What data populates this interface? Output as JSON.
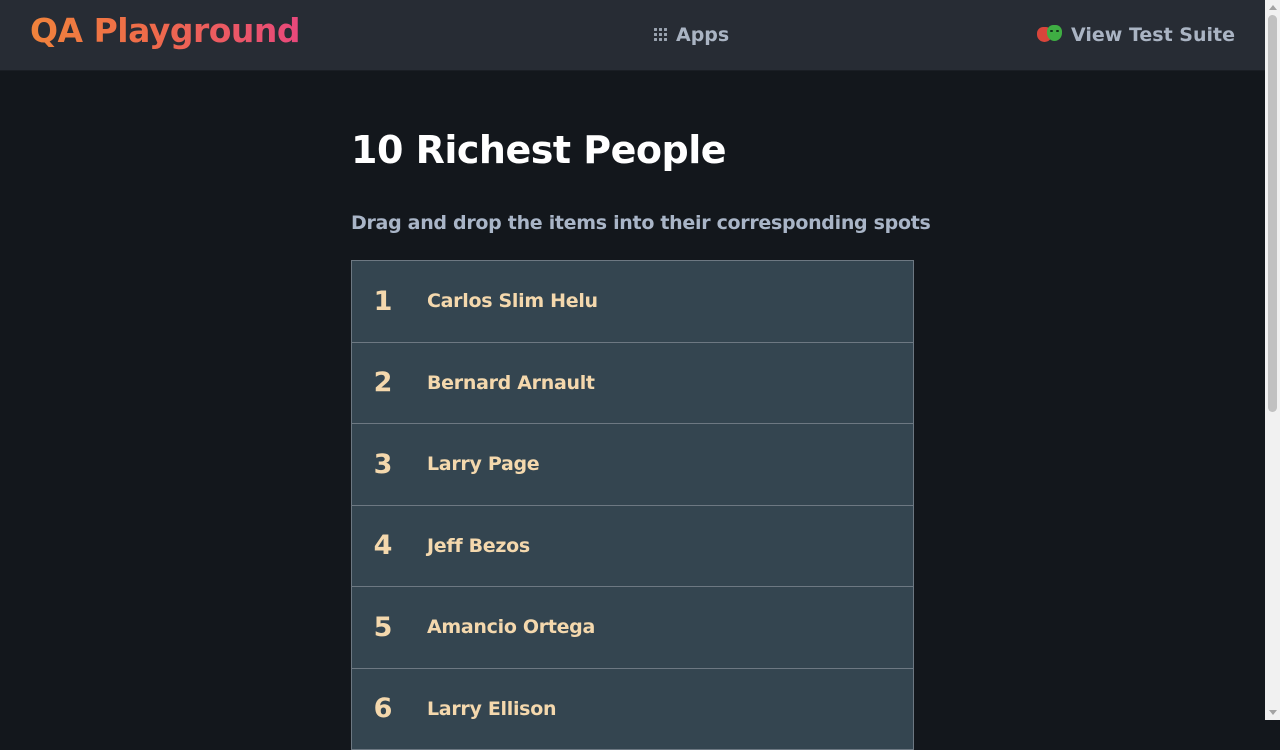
{
  "navbar": {
    "brand": "QA Playground",
    "apps_label": "Apps",
    "apps_icon": "grid-icon",
    "suite_label": "View Test Suite",
    "suite_icon": "theater-masks-icon"
  },
  "main": {
    "title": "10 Richest People",
    "subtitle": "Drag and drop the items into their corresponding spots",
    "items": [
      {
        "rank": "1",
        "name": "Carlos Slim Helu"
      },
      {
        "rank": "2",
        "name": "Bernard Arnault"
      },
      {
        "rank": "3",
        "name": "Larry Page"
      },
      {
        "rank": "4",
        "name": "Jeff Bezos"
      },
      {
        "rank": "5",
        "name": "Amancio Ortega"
      },
      {
        "rank": "6",
        "name": "Larry Ellison"
      }
    ]
  },
  "colors": {
    "background": "#13171c",
    "navbar": "#272c34",
    "item_background": "#344550",
    "item_text": "#f4d8ad",
    "brand_gradient": [
      "#f0833c",
      "#e8487c"
    ]
  }
}
